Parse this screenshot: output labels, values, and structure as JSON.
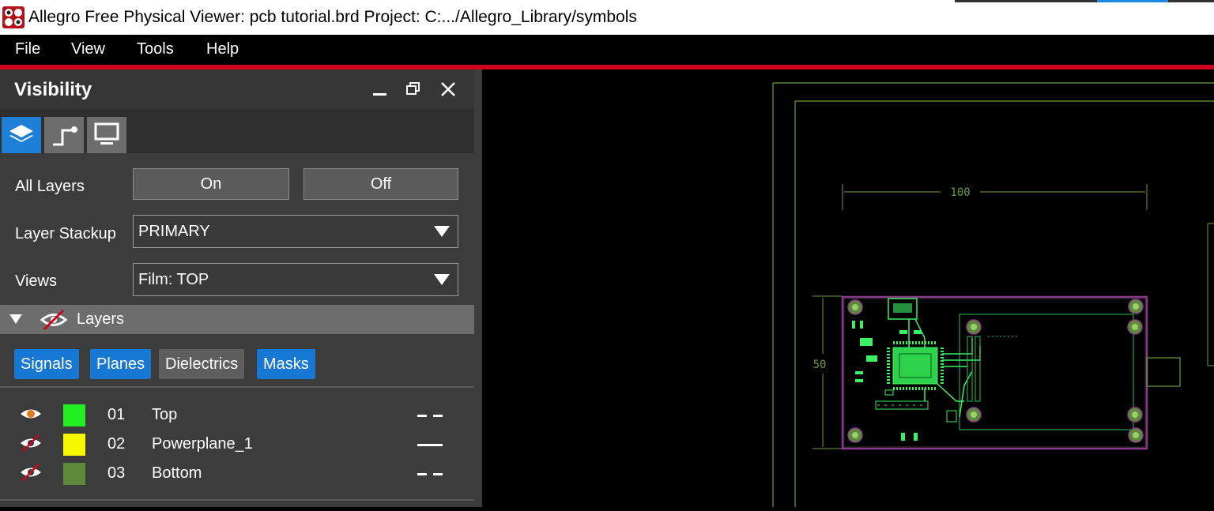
{
  "window": {
    "title": "Allegro Free Physical Viewer: pcb tutorial.brd  Project: C:.../Allegro_Library/symbols"
  },
  "menu": [
    "File",
    "View",
    "Tools",
    "Help"
  ],
  "panel": {
    "title": "Visibility",
    "all_layers_label": "All Layers",
    "on_label": "On",
    "off_label": "Off",
    "stackup_label": "Layer Stackup",
    "stackup_value": "PRIMARY",
    "views_label": "Views",
    "views_value": "Film: TOP",
    "layers_section": "Layers",
    "filters": [
      "Signals",
      "Planes",
      "Dielectrics",
      "Masks"
    ],
    "layers": [
      {
        "num": "01",
        "name": "Top",
        "visible": true,
        "color": "#22ee22"
      },
      {
        "num": "02",
        "name": "Powerplane_1",
        "visible": false,
        "color": "#f7f700"
      },
      {
        "num": "03",
        "name": "Bottom",
        "visible": false,
        "color": "#5c8a3a"
      }
    ]
  },
  "board": {
    "width_dim": "100",
    "height_dim": "50"
  },
  "colors": {
    "accent": "#1e7fd6",
    "redline": "#d0021b",
    "outline_green": "#6e9c3c",
    "board_outline": "#8b3a8b"
  }
}
